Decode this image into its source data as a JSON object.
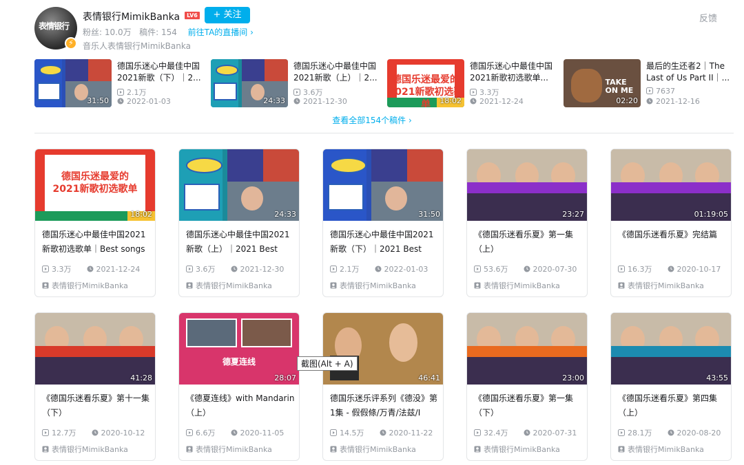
{
  "header": {
    "avatar_text": "表情银行",
    "avatar_badge": "⚡",
    "username": "表情银行MimikBanka",
    "level": "LV6",
    "follow_label": "+ 关注",
    "fans_label": "粉丝:",
    "fans_value": "10.0万",
    "works_label": "稿件:",
    "works_value": "154",
    "live_link": "前往TA的直播间 ›",
    "subtitle": "音乐人表情银行MimikBanka",
    "feedback": "反馈"
  },
  "recent": [
    {
      "title": "德国乐迷心中最佳中国2021新歌（下）｜2...",
      "views": "2.1万",
      "date": "2022-01-03",
      "duration": "31:50",
      "art": "collage-blue"
    },
    {
      "title": "德国乐迷心中最佳中国2021新歌（上）｜2...",
      "views": "3.6万",
      "date": "2021-12-30",
      "duration": "24:33",
      "art": "collage"
    },
    {
      "title": "德国乐迷心中最佳中国2021新歌初选歌单...",
      "views": "3.3万",
      "date": "2021-12-24",
      "duration": "18:02",
      "art": "red"
    },
    {
      "title": "最后的生还者2｜The Last of Us Part II｜...",
      "views": "7637",
      "date": "2021-12-16",
      "duration": "02:20",
      "art": "guitar"
    }
  ],
  "view_all": "查看全部154个稿件 ›",
  "cards": [
    {
      "title": "德国乐迷心中最佳中国2021新歌初选歌单｜Best songs",
      "views": "3.3万",
      "date": "2021-12-24",
      "author": "表情银行MimikBanka",
      "duration": "18:02",
      "art": "red"
    },
    {
      "title": "德国乐迷心中最佳中国2021新歌（上）｜2021 Best",
      "views": "3.6万",
      "date": "2021-12-30",
      "author": "表情银行MimikBanka",
      "duration": "24:33",
      "art": "collage"
    },
    {
      "title": "德国乐迷心中最佳中国2021新歌（下）｜2021 Best",
      "views": "2.1万",
      "date": "2022-01-03",
      "author": "表情银行MimikBanka",
      "duration": "31:50",
      "art": "collage-blue"
    },
    {
      "title": "《德国乐迷看乐夏》第一集（上）",
      "views": "53.6万",
      "date": "2020-07-30",
      "author": "表情银行MimikBanka",
      "duration": "23:27",
      "art": "room-purple"
    },
    {
      "title": "《德国乐迷看乐夏》完结篇",
      "views": "16.3万",
      "date": "2020-10-17",
      "author": "表情银行MimikBanka",
      "duration": "01:19:05",
      "art": "room-purple"
    },
    {
      "title": "《德国乐迷看乐夏》第十一集（下）",
      "views": "12.7万",
      "date": "2020-10-12",
      "author": "表情银行MimikBanka",
      "duration": "41:28",
      "art": "room-red"
    },
    {
      "title": "《德夏连线》with Mandarin（上）",
      "views": "6.6万",
      "date": "2020-11-05",
      "author": "表情银行MimikBanka",
      "duration": "28:07",
      "art": "pink"
    },
    {
      "title": "德国乐迷乐评系列《德没》第1集 - 假假條/万青/法兹/I",
      "views": "14.5万",
      "date": "2020-11-22",
      "author": "表情银行MimikBanka",
      "duration": "46:41",
      "art": "warm"
    },
    {
      "title": "《德国乐迷看乐夏》第一集（下）",
      "views": "32.4万",
      "date": "2020-07-31",
      "author": "表情银行MimikBanka",
      "duration": "23:00",
      "art": "room-orange"
    },
    {
      "title": "《德国乐迷看乐夏》第四集（上）",
      "views": "28.1万",
      "date": "2020-08-20",
      "author": "表情银行MimikBanka",
      "duration": "43:55",
      "art": "room-teal"
    }
  ],
  "thumb_text": {
    "red": "德国乐迷最爱的\n2021新歌初选歌单",
    "pink": "德夏连线",
    "guitar": "TAKE\nON ME"
  },
  "tooltip": "截图(Alt + A)",
  "colors": {
    "accent": "#00aeec",
    "muted": "#9499a0",
    "level": "#f04c49"
  }
}
